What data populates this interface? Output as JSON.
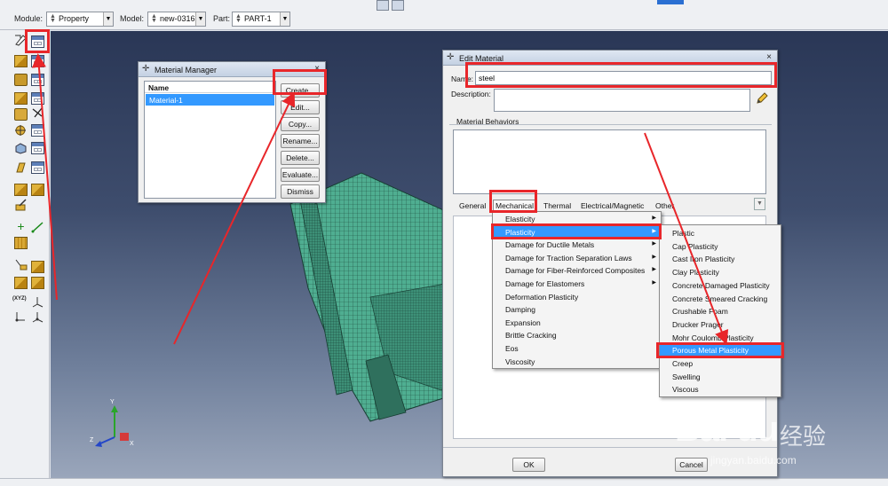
{
  "context_bar": {
    "module_label": "Module:",
    "module_value": "Property",
    "model_label": "Model:",
    "model_value": "new-0316",
    "part_label": "Part:",
    "part_value": "PART-1"
  },
  "material_manager": {
    "title": "Material Manager",
    "close": "×",
    "list_header": "Name",
    "items": [
      "Material-1"
    ],
    "buttons": {
      "create": "Create...",
      "edit": "Edit...",
      "copy": "Copy...",
      "rename": "Rename...",
      "delete": "Delete...",
      "evaluate": "Evaluate...",
      "dismiss": "Dismiss"
    }
  },
  "edit_material": {
    "title": "Edit Material",
    "close": "×",
    "name_label": "Name:",
    "name_value": "steel",
    "description_label": "Description:",
    "behaviors_label": "Material Behaviors",
    "menu": {
      "general": "General",
      "mechanical": "Mechanical",
      "thermal": "Thermal",
      "electrical": "Electrical/Magnetic",
      "other": "Other"
    },
    "ok": "OK",
    "cancel": "Cancel"
  },
  "mechanical_menu": [
    {
      "label": "Elasticity",
      "submenu": true
    },
    {
      "label": "Plasticity",
      "submenu": true,
      "selected": true
    },
    {
      "label": "Damage for Ductile Metals",
      "submenu": true
    },
    {
      "label": "Damage for Traction Separation Laws",
      "submenu": true
    },
    {
      "label": "Damage for Fiber-Reinforced Composites",
      "submenu": true
    },
    {
      "label": "Damage for Elastomers",
      "submenu": true
    },
    {
      "label": "Deformation Plasticity",
      "submenu": false
    },
    {
      "label": "Damping",
      "submenu": false
    },
    {
      "label": "Expansion",
      "submenu": false
    },
    {
      "label": "Brittle Cracking",
      "submenu": false
    },
    {
      "label": "Eos",
      "submenu": false
    },
    {
      "label": "Viscosity",
      "submenu": false
    }
  ],
  "plasticity_menu": [
    {
      "label": "Plastic"
    },
    {
      "label": "Cap Plasticity"
    },
    {
      "label": "Cast Iron Plasticity"
    },
    {
      "label": "Clay Plasticity"
    },
    {
      "label": "Concrete Damaged Plasticity"
    },
    {
      "label": "Concrete Smeared Cracking"
    },
    {
      "label": "Crushable Foam"
    },
    {
      "label": "Drucker Prager"
    },
    {
      "label": "Mohr Coulomb Plasticity"
    },
    {
      "label": "Porous Metal Plasticity",
      "selected": true
    },
    {
      "label": "Creep"
    },
    {
      "label": "Swelling"
    },
    {
      "label": "Viscous"
    }
  ],
  "triad": {
    "x": "X",
    "y": "Y",
    "z": "Z"
  },
  "toolbox_text": {
    "xyz": "(XYZ)"
  },
  "watermark": {
    "logo": "Bai du",
    "cn": "经验",
    "url": "jingyan.baidu.com"
  },
  "colors": {
    "annotation_red": "#e8262a",
    "selection_blue": "#3399ff",
    "mesh_green": "#4fae91",
    "viewport_top": "#2a3756",
    "viewport_bottom": "#9aa6bb"
  }
}
